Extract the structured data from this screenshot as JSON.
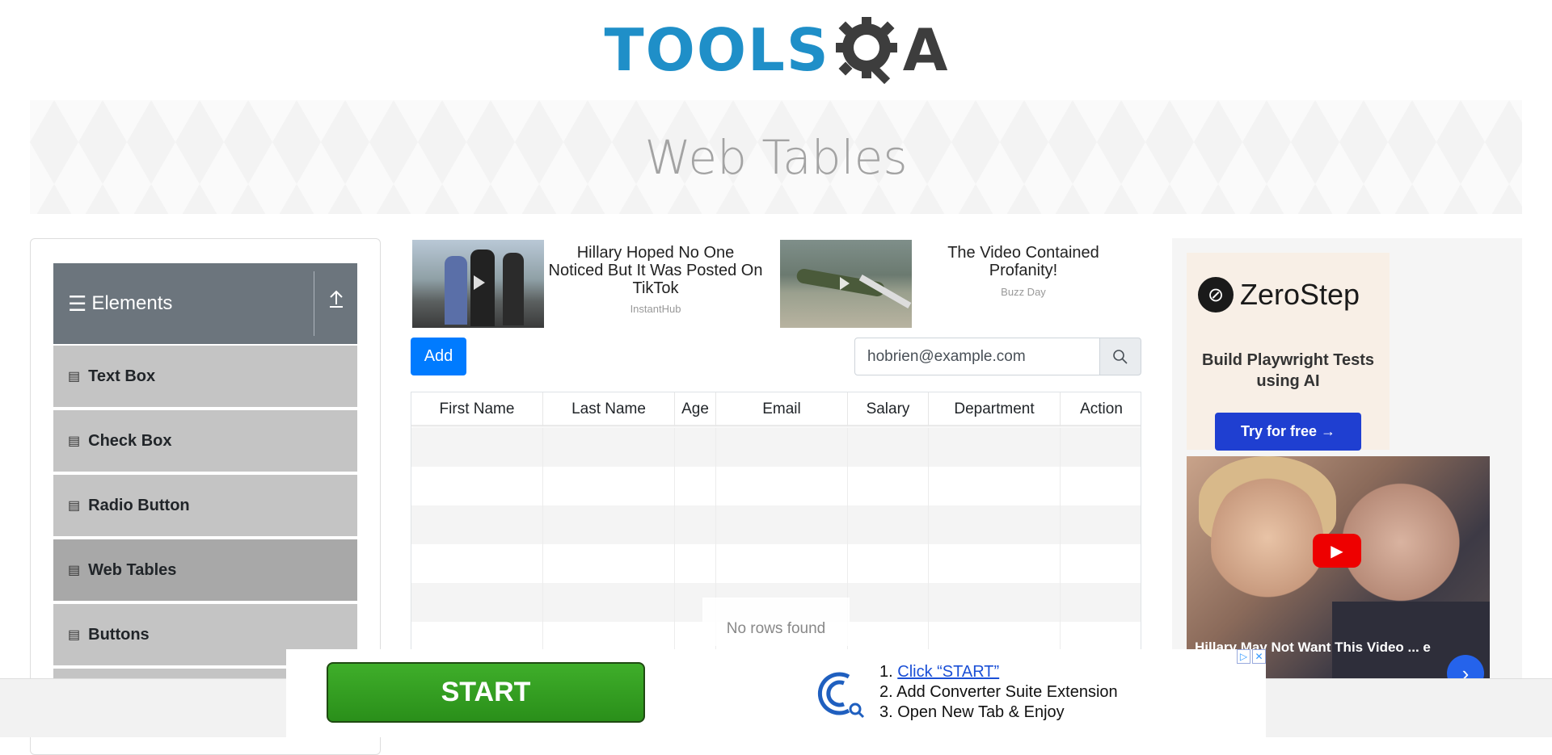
{
  "logo": {
    "text": "TOOLS",
    "gear": "⚙",
    "suffix": "A"
  },
  "page_title": "Web Tables",
  "sidebar": {
    "group_title": "Elements",
    "items": [
      {
        "label": "Text Box",
        "active": false
      },
      {
        "label": "Check Box",
        "active": false
      },
      {
        "label": "Radio Button",
        "active": false
      },
      {
        "label": "Web Tables",
        "active": true
      },
      {
        "label": "Buttons",
        "active": false
      }
    ]
  },
  "ads": [
    {
      "title": "Hillary Hoped No One Noticed But It Was Posted On TikTok",
      "source": "InstantHub"
    },
    {
      "title": "The Video Contained Profanity!",
      "source": "Buzz Day"
    }
  ],
  "toolbar": {
    "add_label": "Add"
  },
  "search": {
    "value": "hobrien@example.com"
  },
  "table": {
    "columns": [
      "First Name",
      "Last Name",
      "Age",
      "Email",
      "Salary",
      "Department",
      "Action"
    ],
    "empty_message": "No rows found"
  },
  "right_ad": {
    "brand": "ZeroStep",
    "tagline": "Build Playwright Tests using AI",
    "cta": "Try for free →",
    "video_caption": "Hillary May Not Want This Video ... e Rounds"
  },
  "bottom_ad": {
    "start_label": "START",
    "steps": [
      "Click “START”",
      "Add Converter Suite Extension",
      "Open New Tab & Enjoy"
    ]
  },
  "colors": {
    "primary": "#007bff",
    "sidebar_header": "#6c757d",
    "sidebar_item": "#c4c4c4",
    "logo_blue": "#1f8fc8"
  }
}
